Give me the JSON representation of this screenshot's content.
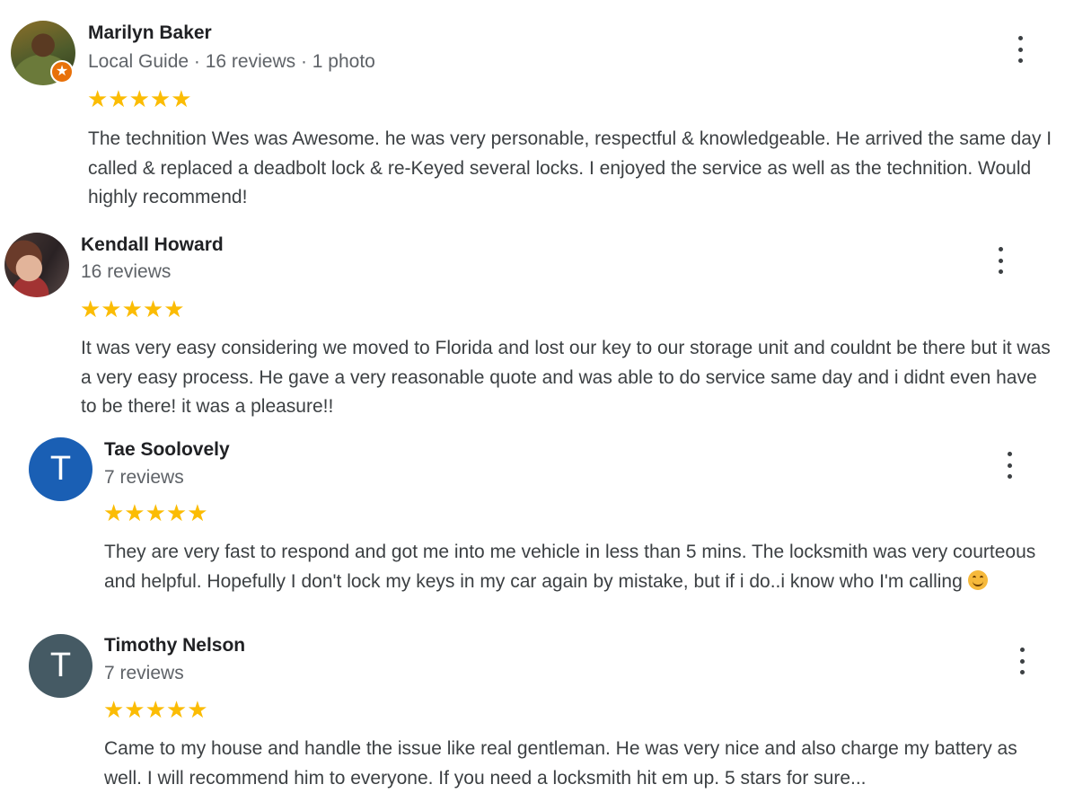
{
  "reviews": [
    {
      "name": "Marilyn Baker",
      "meta": "Local Guide · 16 reviews · 1 photo",
      "avatar_icon": "profile-photo",
      "badge_icon": "local-guide-star-icon",
      "rating": "★★★★★",
      "text": "The technition Wes was Awesome. he was very personable, respectful & knowledgeable. He arrived the same day I called & replaced a deadbolt lock & re-Keyed several locks. I enjoyed the service as well as the technition. Would highly recommend!"
    },
    {
      "name": "Kendall Howard",
      "meta": "16 reviews",
      "avatar_icon": "profile-photo",
      "rating": "★★★★★",
      "text": "It was very easy considering we moved to Florida and lost our key to our storage unit and couldnt be there but it was a very easy process. He gave a very reasonable quote and was able to do service same day and i didnt even have to be there! it was a pleasure!!"
    },
    {
      "name": "Tae Soolovely",
      "meta": "7 reviews",
      "avatar_letter": "T",
      "avatar_color": "#1a5fb4",
      "rating": "★★★★★",
      "text": "They are very fast to respond and got me into me vehicle in less than 5 mins. The locksmith was very courteous and helpful. Hopefully I don't lock my keys in my car again by mistake, but if i do..i know who I'm calling",
      "emoji": "smiling-face-icon"
    },
    {
      "name": "Timothy Nelson",
      "meta": "7 reviews",
      "avatar_letter": "T",
      "avatar_color": "#455a64",
      "rating": "★★★★★",
      "text": "Came to my house and handle the issue like real gentleman. He was very nice and also charge my battery as well. I will recommend him to everyone. If you need a locksmith hit em up. 5 stars for sure..."
    }
  ],
  "colors": {
    "star": "#fbbc04",
    "local_guide_badge": "#e8710a",
    "name_text": "#202124",
    "meta_text": "#5f6368"
  },
  "menu_icon": "more-vert-icon"
}
